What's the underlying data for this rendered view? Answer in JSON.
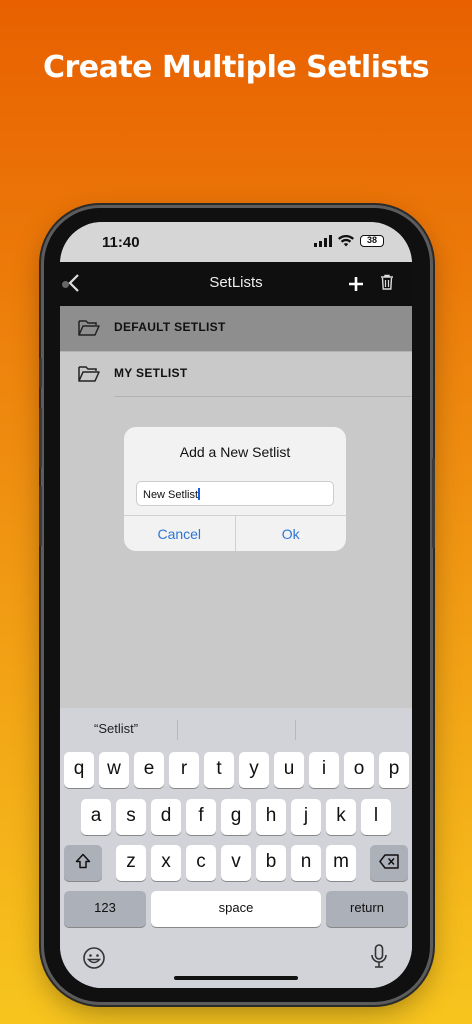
{
  "promo": {
    "title": "Create Multiple Setlists"
  },
  "status": {
    "time": "11:40",
    "battery": "38"
  },
  "nav": {
    "title": "SetLists",
    "back_icon": "chevron-left-icon",
    "add_icon": "plus-icon",
    "trash_icon": "trash-icon"
  },
  "setlists": [
    {
      "name": "DEFAULT SETLIST",
      "selected": true
    },
    {
      "name": "MY SETLIST",
      "selected": false
    }
  ],
  "dialog": {
    "title": "Add a New Setlist",
    "input_value": "New Setlist",
    "cancel_label": "Cancel",
    "ok_label": "Ok"
  },
  "keyboard": {
    "suggestions": [
      "“Setlist”",
      "",
      ""
    ],
    "row1": [
      "q",
      "w",
      "e",
      "r",
      "t",
      "y",
      "u",
      "i",
      "o",
      "p"
    ],
    "row2": [
      "a",
      "s",
      "d",
      "f",
      "g",
      "h",
      "j",
      "k",
      "l"
    ],
    "row3": [
      "z",
      "x",
      "c",
      "v",
      "b",
      "n",
      "m"
    ],
    "numbers_label": "123",
    "space_label": "space",
    "return_label": "return"
  },
  "colors": {
    "accent_blue": "#2e76d4",
    "navbar": "#0f0f0f",
    "gradient_top": "#e86000",
    "gradient_bottom": "#f7c51e"
  }
}
